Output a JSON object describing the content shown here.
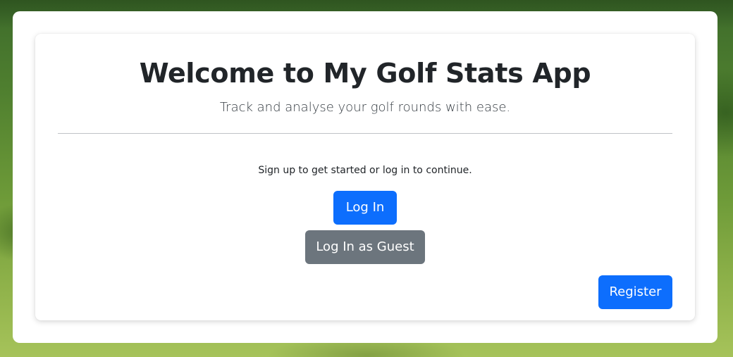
{
  "header": {
    "title": "Welcome to My Golf Stats App",
    "subtitle": "Track and analyse your golf rounds with ease."
  },
  "main": {
    "prompt": "Sign up to get started or log in to continue.",
    "login_label": "Log In",
    "guest_login_label": "Log In as Guest",
    "register_label": "Register"
  },
  "colors": {
    "primary": "#0d6efd",
    "secondary": "#6c757d",
    "text": "#212529"
  }
}
